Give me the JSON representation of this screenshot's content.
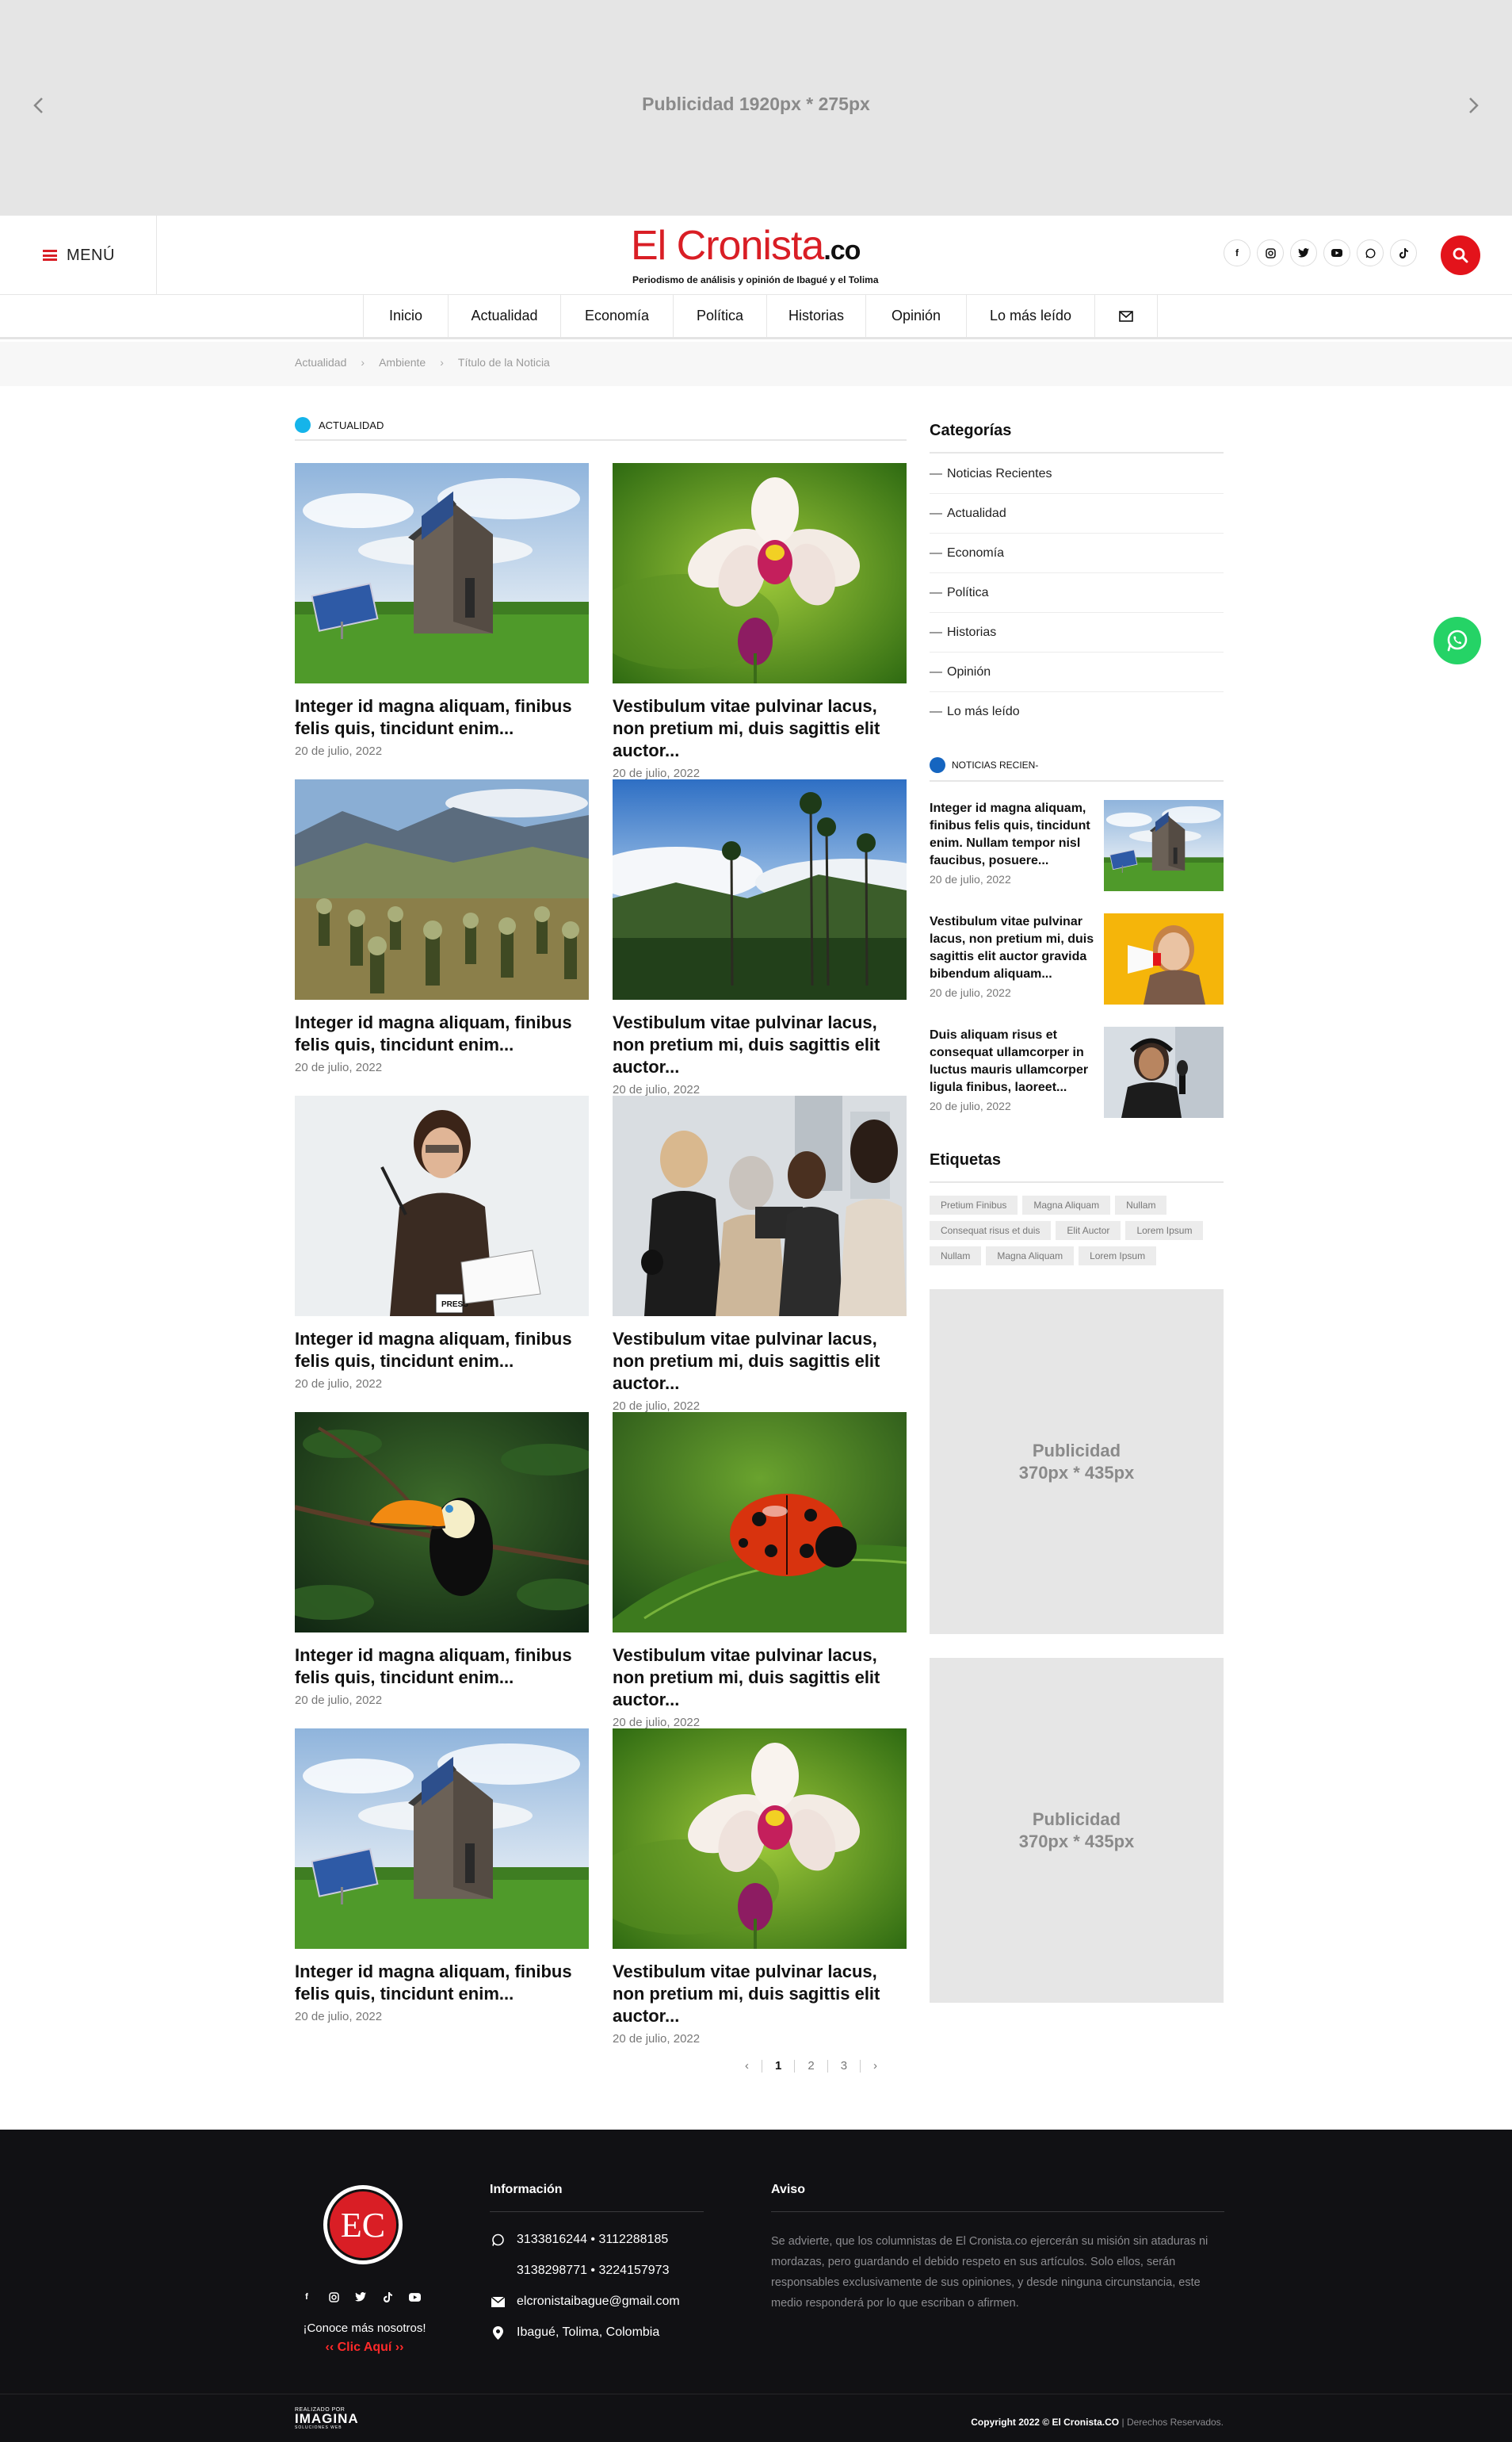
{
  "top_ad": {
    "text": "Publicidad 1920px * 275px"
  },
  "header": {
    "menu_label": "MENÚ",
    "logo_main": "El Cronista",
    "logo_tld": ".co",
    "logo_tagline": "Periodismo de análisis y opinión de Ibagué y el Tolima",
    "socials": [
      "facebook-icon",
      "instagram-icon",
      "twitter-icon",
      "youtube-icon",
      "whatsapp-icon",
      "tiktok-icon"
    ],
    "brand_color": "#d91e25"
  },
  "nav": {
    "items": [
      "Inicio",
      "Actualidad",
      "Economía",
      "Política",
      "Historias",
      "Opinión",
      "Lo más leído"
    ],
    "mail_icon": "mail-icon"
  },
  "breadcrumb": {
    "items": [
      "Actualidad",
      "Ambiente",
      "Título de la Noticia"
    ]
  },
  "section": {
    "title": "ACTUALIDAD",
    "dot_color": "#15b4ea"
  },
  "articles": [
    {
      "title": "Integer id magna aliquam, finibus felis quis, tincidunt enim...",
      "date": "20 de julio, 2022",
      "image": "house-solar"
    },
    {
      "title": "Vestibulum vitae pulvinar lacus, non pretium mi, duis sagittis elit auctor...",
      "date": "20 de julio, 2022",
      "image": "orchid"
    },
    {
      "title": "Integer id magna aliquam, finibus felis quis, tincidunt enim...",
      "date": "20 de julio, 2022",
      "image": "paramo"
    },
    {
      "title": "Vestibulum vitae pulvinar lacus, non pretium mi, duis sagittis elit auctor...",
      "date": "20 de julio, 2022",
      "image": "palms"
    },
    {
      "title": "Integer id magna aliquam, finibus felis quis, tincidunt enim...",
      "date": "20 de julio, 2022",
      "image": "journalist"
    },
    {
      "title": "Vestibulum vitae pulvinar lacus, non pretium mi, duis sagittis elit auctor...",
      "date": "20 de julio, 2022",
      "image": "press"
    },
    {
      "title": "Integer id magna aliquam, finibus felis quis, tincidunt enim...",
      "date": "20 de julio, 2022",
      "image": "toucan"
    },
    {
      "title": "Vestibulum vitae pulvinar lacus, non pretium mi, duis sagittis elit auctor...",
      "date": "20 de julio, 2022",
      "image": "ladybug"
    },
    {
      "title": "Integer id magna aliquam, finibus felis quis, tincidunt enim...",
      "date": "20 de julio, 2022",
      "image": "house-solar"
    },
    {
      "title": "Vestibulum vitae pulvinar lacus, non pretium mi, duis sagittis elit auctor...",
      "date": "20 de julio, 2022",
      "image": "orchid"
    }
  ],
  "pagination": {
    "prev": "‹",
    "pages": [
      "1",
      "2",
      "3"
    ],
    "current": "1",
    "next": "›"
  },
  "sidebar": {
    "categories_title": "Categorías",
    "categories": [
      "Noticias Recientes",
      "Actualidad",
      "Economía",
      "Política",
      "Historias",
      "Opinión",
      "Lo más leído"
    ],
    "recent_title": "NOTICIAS RECIEN-",
    "recent_dot_color": "#1565c0",
    "recent": [
      {
        "title": "Integer id magna aliquam, finibus felis quis, tincidunt enim. Nullam tempor nisl faucibus, posuere...",
        "date": "20 de julio, 2022",
        "image": "house-solar"
      },
      {
        "title": "Vestibulum vitae pulvinar lacus, non pretium mi, duis sagittis elit auctor gravida bibendum aliquam...",
        "date": "20 de julio, 2022",
        "image": "megaphone"
      },
      {
        "title": "Duis aliquam risus et consequat ullamcorper in luctus mauris ullamcorper ligula finibus, laoreet...",
        "date": "20 de julio, 2022",
        "image": "podcast"
      }
    ],
    "tags_title": "Etiquetas",
    "tags": [
      "Pretium Finibus",
      "Magna Aliquam",
      "Nullam",
      "Consequat risus et duis",
      "Elit Auctor",
      "Lorem Ipsum",
      "Nullam",
      "Magna Aliquam",
      "Lorem Ipsum"
    ],
    "ads": [
      {
        "line1": "Publicidad",
        "line2": "370px * 435px"
      },
      {
        "line1": "Publicidad",
        "line2": "370px * 435px"
      }
    ]
  },
  "whatsapp_float": {
    "icon": "whatsapp-icon",
    "color": "#25d366"
  },
  "footer": {
    "logo_text": "EC",
    "socials": [
      "facebook-icon",
      "instagram-icon",
      "twitter-icon",
      "tiktok-icon",
      "youtube-icon"
    ],
    "know_more": "¡Conoce más nosotros!",
    "click_here": "‹‹ Clic Aquí ››",
    "info_title": "Información",
    "phones_line1": "3133816244  •  3112288185",
    "phones_line2": "3138298771  •  3224157973",
    "email": "elcronistaibague@gmail.com",
    "location": "Ibagué, Tolima, Colombia",
    "notice_title": "Aviso",
    "notice_text": "Se advierte, que los columnistas de El Cronista.co ejercerán su misión sin ataduras ni mordazas, pero guardando el debido respeto en sus artículos. Solo ellos, serán responsables exclusivamente de sus opiniones, y desde ninguna circunstancia, este medio responderá por lo que escriban o afirmen.",
    "credit_small": "REALIZADO POR",
    "credit_brand": "IMAGINA",
    "credit_sub": "SOLUCIONES WEB",
    "copyright": "Copyright 2022 © El Cronista.CO",
    "rights": "Derechos Reservados."
  }
}
